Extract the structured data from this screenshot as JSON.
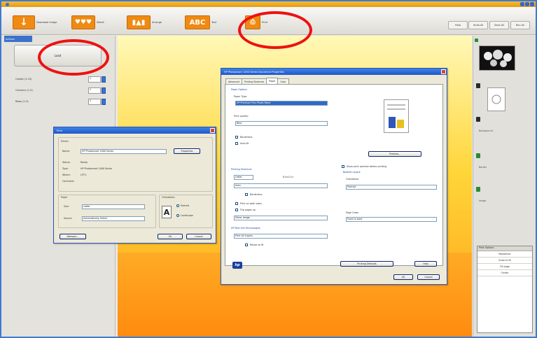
{
  "toolbar": {
    "buttons": [
      {
        "icon": "↓",
        "label": "Download image",
        "width": 32
      },
      {
        "icon": "♥♥♥",
        "label": "Select",
        "width": 32
      },
      {
        "icon": "▮▲▮",
        "label": "Arrange",
        "width": 34
      },
      {
        "icon": "ABC",
        "label": "Text",
        "width": 34
      },
      {
        "icon": "⎙",
        "label": "Print",
        "width": 22
      }
    ],
    "right_buttons": [
      "Help",
      "Undo All",
      "Save All",
      "Run All"
    ]
  },
  "left_pane": {
    "tab_label": "Actions",
    "load_label": "Load",
    "params": [
      {
        "label": "Copies (1-10)",
        "value": "1"
      },
      {
        "label": "Columns (1-5)",
        "value": "1"
      },
      {
        "label": "Rows (1-5)",
        "value": "1"
      }
    ]
  },
  "right_pane": {
    "labels": [
      "Image",
      "Frame",
      "Background",
      "Border"
    ],
    "list_header": "Print Options",
    "list_items": [
      "Reposition",
      "Scale to fit",
      "Fill page",
      "Center"
    ]
  },
  "print_dialog": {
    "title": "Print",
    "printer_group": "Printer",
    "name_label": "Name:",
    "printer_name": "HP Photosmart 1000 Series",
    "properties_label": "Properties",
    "status_label": "Status:",
    "status_value": "Ready",
    "type_label": "Type:",
    "type_value": "HP Photosmart 1000 Series",
    "where_label": "Where:",
    "where_value": "LPT1:",
    "comment_label": "Comment:",
    "paper_group": "Paper",
    "size_label": "Size:",
    "size_value": "Letter",
    "source_label": "Source:",
    "source_value": "Automatically Select",
    "orientation_group": "Orientation",
    "portrait_label": "Portrait",
    "landscape_label": "Landscape",
    "network_label": "Network...",
    "ok_label": "OK",
    "cancel_label": "Cancel"
  },
  "properties_dialog": {
    "title": "HP Photosmart 1000 Series Document Properties",
    "tabs": [
      "Advanced",
      "Printing Shortcuts",
      "Paper",
      "Color"
    ],
    "paper_options": "Paper Options",
    "paper_type_label": "Paper Type:",
    "paper_type_value": "HP Premium Plus Photo Paper",
    "print_quality_label": "Print quality:",
    "print_quality_value": "Best",
    "borderless_label": "Borderless",
    "auto_fit_label": "Auto-fit",
    "preview_button": "Preview...",
    "size_options": "Printing Shortcuts",
    "size_label": "Size:",
    "size_value": "Letter",
    "size_dims": "8.5x11 in",
    "borderless_opt": "Borderless",
    "print_both_label": "Print on both sides",
    "flip_label": "Flip pages up",
    "source_value": "Auto",
    "mirror_label": "Mirror image",
    "copies_label": "HP Real Life Technologies",
    "copies_value": "Print All Copies",
    "zoom_label": "Resize to fit",
    "booklet_label": "Booklet Layout",
    "orientation_label": "Orientation",
    "orientation_value": "Portrait",
    "page_order_label": "Page Order",
    "page_order_value": "Front to back",
    "print_preview_label": "Show print preview before printing",
    "ok_label": "OK",
    "cancel_label": "Cancel",
    "help_label": "Help",
    "print_presets": "Printing Defaults",
    "hp_logo": "hp"
  },
  "colors": {
    "accent_orange": "#ef8a12",
    "title_blue": "#2a5ad4",
    "annotation_red": "#ee1111"
  }
}
